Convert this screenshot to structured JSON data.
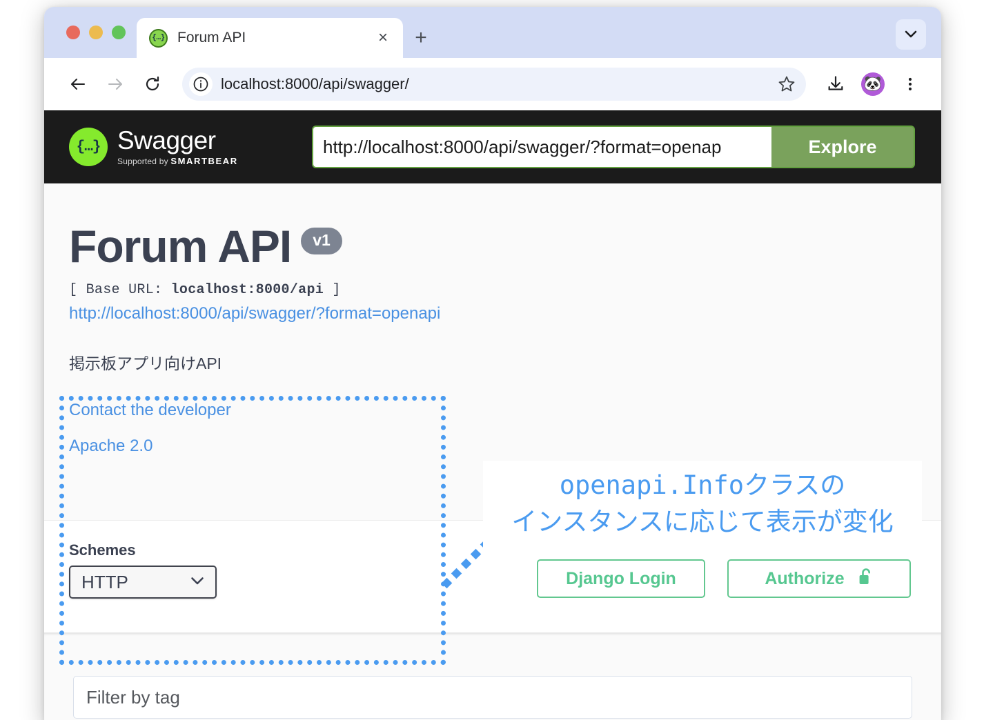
{
  "browser": {
    "tab": {
      "title": "Forum API",
      "favicon": "swagger-favicon",
      "close_label": "×"
    },
    "new_tab_label": "+",
    "tab_list_chevron": "⌄",
    "omnibox": {
      "url": "localhost:8000/api/swagger/",
      "site_info_icon": "info-icon"
    },
    "toolbar": {
      "back_icon": "arrow-left-icon",
      "forward_icon": "arrow-right-icon",
      "reload_icon": "reload-icon",
      "bookmark_icon": "star-icon",
      "download_icon": "download-icon",
      "profile_icon": "🐼",
      "menu_icon": "kebab-menu-icon"
    }
  },
  "swagger_topbar": {
    "logo_glyph": "{…}",
    "wordmark": "Swagger",
    "wordmark_tm": "™",
    "supported_by_prefix": "Supported by ",
    "supported_by_brand": "SMARTBEAR",
    "url_input_value": "http://localhost:8000/api/swagger/?format=openap",
    "explore_label": "Explore"
  },
  "info": {
    "title": "Forum API",
    "version_badge": "v1",
    "base_url_prefix": "[ Base URL: ",
    "base_url_value": "localhost:8000/api",
    "base_url_suffix": " ]",
    "spec_link": "http://localhost:8000/api/swagger/?format=openapi",
    "description": "掲示板アプリ向けAPI",
    "contact_link": "Contact the developer",
    "license_link": "Apache 2.0"
  },
  "annotation": {
    "line1": "openapi.Infoクラスの",
    "line2": "インスタンスに応じて表示が変化",
    "color": "#4a9bf0"
  },
  "schemes": {
    "label": "Schemes",
    "selected": "HTTP",
    "chevron": "⌄",
    "options": [
      "HTTP"
    ]
  },
  "auth": {
    "django_login_label": "Django Login",
    "authorize_label": "Authorize",
    "lock_icon": "unlocked-padlock-icon"
  },
  "filter": {
    "placeholder": "Filter by tag",
    "value": ""
  },
  "colors": {
    "swagger_green": "#85ea2d",
    "explore_green": "#7aa25c",
    "topbar_dark": "#1b1b1b",
    "link_blue": "#4990e2",
    "annotation_blue": "#4a9bf0",
    "auth_green": "#56c790",
    "badge_gray": "#7d8492",
    "title_slate": "#3b4151"
  }
}
